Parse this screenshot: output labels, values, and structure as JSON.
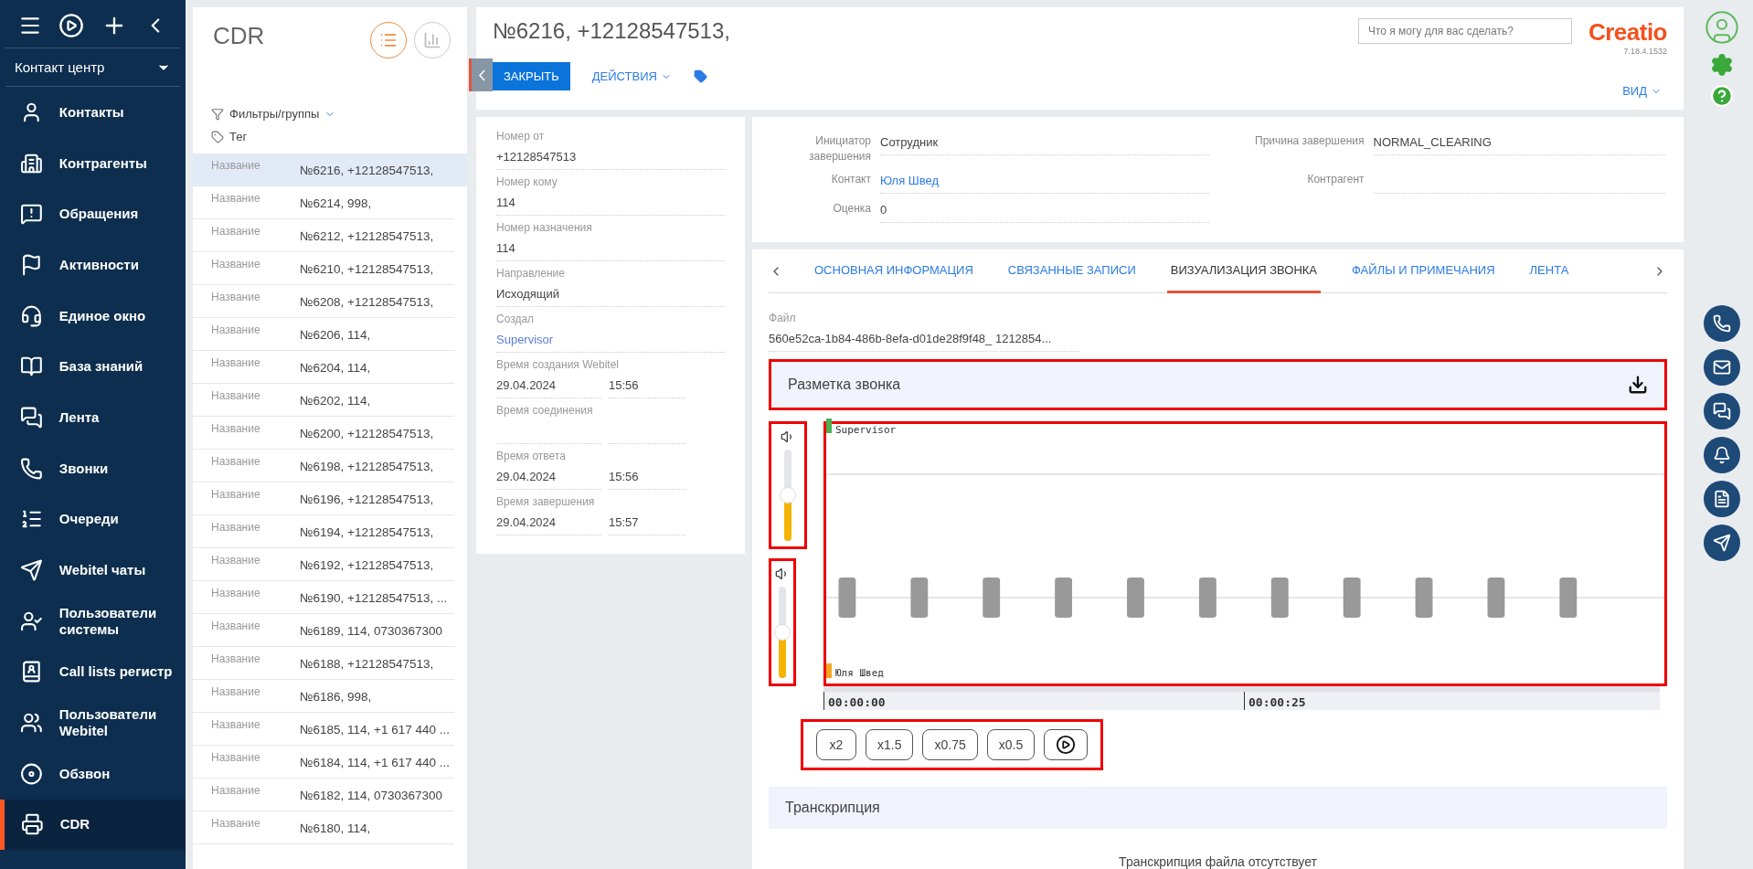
{
  "nav": {
    "workspace": "Контакт центр",
    "items": [
      {
        "label": "Контакты",
        "selected": false
      },
      {
        "label": "Контрагенты",
        "selected": false
      },
      {
        "label": "Обращения",
        "selected": false
      },
      {
        "label": "Активности",
        "selected": false
      },
      {
        "label": "Единое окно",
        "selected": false
      },
      {
        "label": "База знаний",
        "selected": false
      },
      {
        "label": "Лента",
        "selected": false
      },
      {
        "label": "Звонки",
        "selected": false
      },
      {
        "label": "Очереди",
        "selected": false
      },
      {
        "label": "Webitel чаты",
        "selected": false
      },
      {
        "label": "Пользователи системы",
        "selected": false
      },
      {
        "label": "Call lists регистр",
        "selected": false
      },
      {
        "label": "Пользователи Webitel",
        "selected": false
      },
      {
        "label": "Обзвон",
        "selected": false
      },
      {
        "label": "CDR",
        "selected": true
      }
    ]
  },
  "list": {
    "title": "CDR",
    "views": [
      {
        "kind": "list",
        "selected": true
      },
      {
        "kind": "chart",
        "selected": false
      }
    ],
    "filters": "Фильтры/группы",
    "tag": "Тег",
    "rows": [
      {
        "label": "Название",
        "value": "№6216, +12128547513,",
        "selected": true
      },
      {
        "label": "Название",
        "value": "№6214, 998,",
        "selected": false
      },
      {
        "label": "Название",
        "value": "№6212, +12128547513,",
        "selected": false
      },
      {
        "label": "Название",
        "value": "№6210, +12128547513,",
        "selected": false
      },
      {
        "label": "Название",
        "value": "№6208, +12128547513,",
        "selected": false
      },
      {
        "label": "Название",
        "value": "№6206, 114,",
        "selected": false
      },
      {
        "label": "Название",
        "value": "№6204, 114,",
        "selected": false
      },
      {
        "label": "Название",
        "value": "№6202, 114,",
        "selected": false
      },
      {
        "label": "Название",
        "value": "№6200, +12128547513,",
        "selected": false
      },
      {
        "label": "Название",
        "value": "№6198, +12128547513,",
        "selected": false
      },
      {
        "label": "Название",
        "value": "№6196, +12128547513,",
        "selected": false
      },
      {
        "label": "Название",
        "value": "№6194, +12128547513,",
        "selected": false
      },
      {
        "label": "Название",
        "value": "№6192, +12128547513,",
        "selected": false
      },
      {
        "label": "Название",
        "value": "№6190, +12128547513, ...",
        "selected": false
      },
      {
        "label": "Название",
        "value": "№6189, 114, 0730367300",
        "selected": false
      },
      {
        "label": "Название",
        "value": "№6188, +12128547513,",
        "selected": false
      },
      {
        "label": "Название",
        "value": "№6186, 998,",
        "selected": false
      },
      {
        "label": "Название",
        "value": "№6185, 114, +1 617 440 ...",
        "selected": false
      },
      {
        "label": "Название",
        "value": "№6184, 114, +1 617 440 ...",
        "selected": false
      },
      {
        "label": "Название",
        "value": "№6182, 114, 0730367300",
        "selected": false
      },
      {
        "label": "Название",
        "value": "№6180, 114,",
        "selected": false
      }
    ]
  },
  "header": {
    "title": "№6216, +12128547513,",
    "close": "ЗАКРЫТЬ",
    "actions": "ДЕЙСТВИЯ",
    "view": "ВИД",
    "search_placeholder": "Что я могу для вас сделать?",
    "logo": "Creatio",
    "version": "7.18.4.1532"
  },
  "info_fields": [
    {
      "kind": "text",
      "label": "Номер от",
      "value": "+12128547513"
    },
    {
      "kind": "text",
      "label": "Номер кому",
      "value": "114"
    },
    {
      "kind": "text",
      "label": "Номер назначения",
      "value": "114"
    },
    {
      "kind": "text",
      "label": "Направление",
      "value": "Исходящий"
    },
    {
      "kind": "link",
      "label": "Создал",
      "value": "Supervisor"
    },
    {
      "kind": "datetime",
      "label": "Время создания Webitel",
      "date": "29.04.2024",
      "time": "15:56"
    },
    {
      "kind": "datetime",
      "label": "Время соединения"
    },
    {
      "kind": "datetime",
      "label": "Время ответа",
      "date": "29.04.2024",
      "time": "15:56"
    },
    {
      "kind": "datetime",
      "label": "Время завершения",
      "date": "29.04.2024",
      "time": "15:57"
    }
  ],
  "details": [
    {
      "label": "Инициатор завершения",
      "value": "Сотрудник",
      "link": false
    },
    {
      "label": "Причина завершения",
      "value": "NORMAL_CLEARING",
      "link": false
    },
    {
      "label": "Контакт",
      "value": "Юля Швед",
      "link": true
    },
    {
      "label": "Контрагент"
    },
    {
      "label": "Оценка",
      "value": "0",
      "link": false
    }
  ],
  "tabs": [
    {
      "label": "ОСНОВНАЯ ИНФОРМАЦИЯ",
      "selected": false
    },
    {
      "label": "СВЯЗАННЫЕ ЗАПИСИ",
      "selected": false
    },
    {
      "label": "ВИЗУАЛИЗАЦИЯ ЗВОНКА",
      "selected": true
    },
    {
      "label": "ФАЙЛЫ И ПРИМЕЧАНИЯ",
      "selected": false
    },
    {
      "label": "ЛЕНТА",
      "selected": false
    }
  ],
  "file": {
    "label": "Файл",
    "value": "560e52ca-1b84-486b-8efa-d01de28f9f48_ 1212854..."
  },
  "markup": {
    "title": "Разметка звонка",
    "highlighted": true
  },
  "player": {
    "highlighted": true,
    "channels": [
      {
        "name": "Supervisor",
        "color": "#4caf50",
        "level": 0.5
      },
      {
        "name": "Юля Швед",
        "color": "#f5a623",
        "level": 0.5
      }
    ],
    "times": [
      "00:00:00",
      "00:00:25"
    ],
    "speeds": [
      "x2",
      "x1.5",
      "x0.75",
      "x0.5"
    ]
  },
  "transcription": {
    "title": "Транскрипция",
    "empty": "Транскрипция файла отсутствует"
  }
}
